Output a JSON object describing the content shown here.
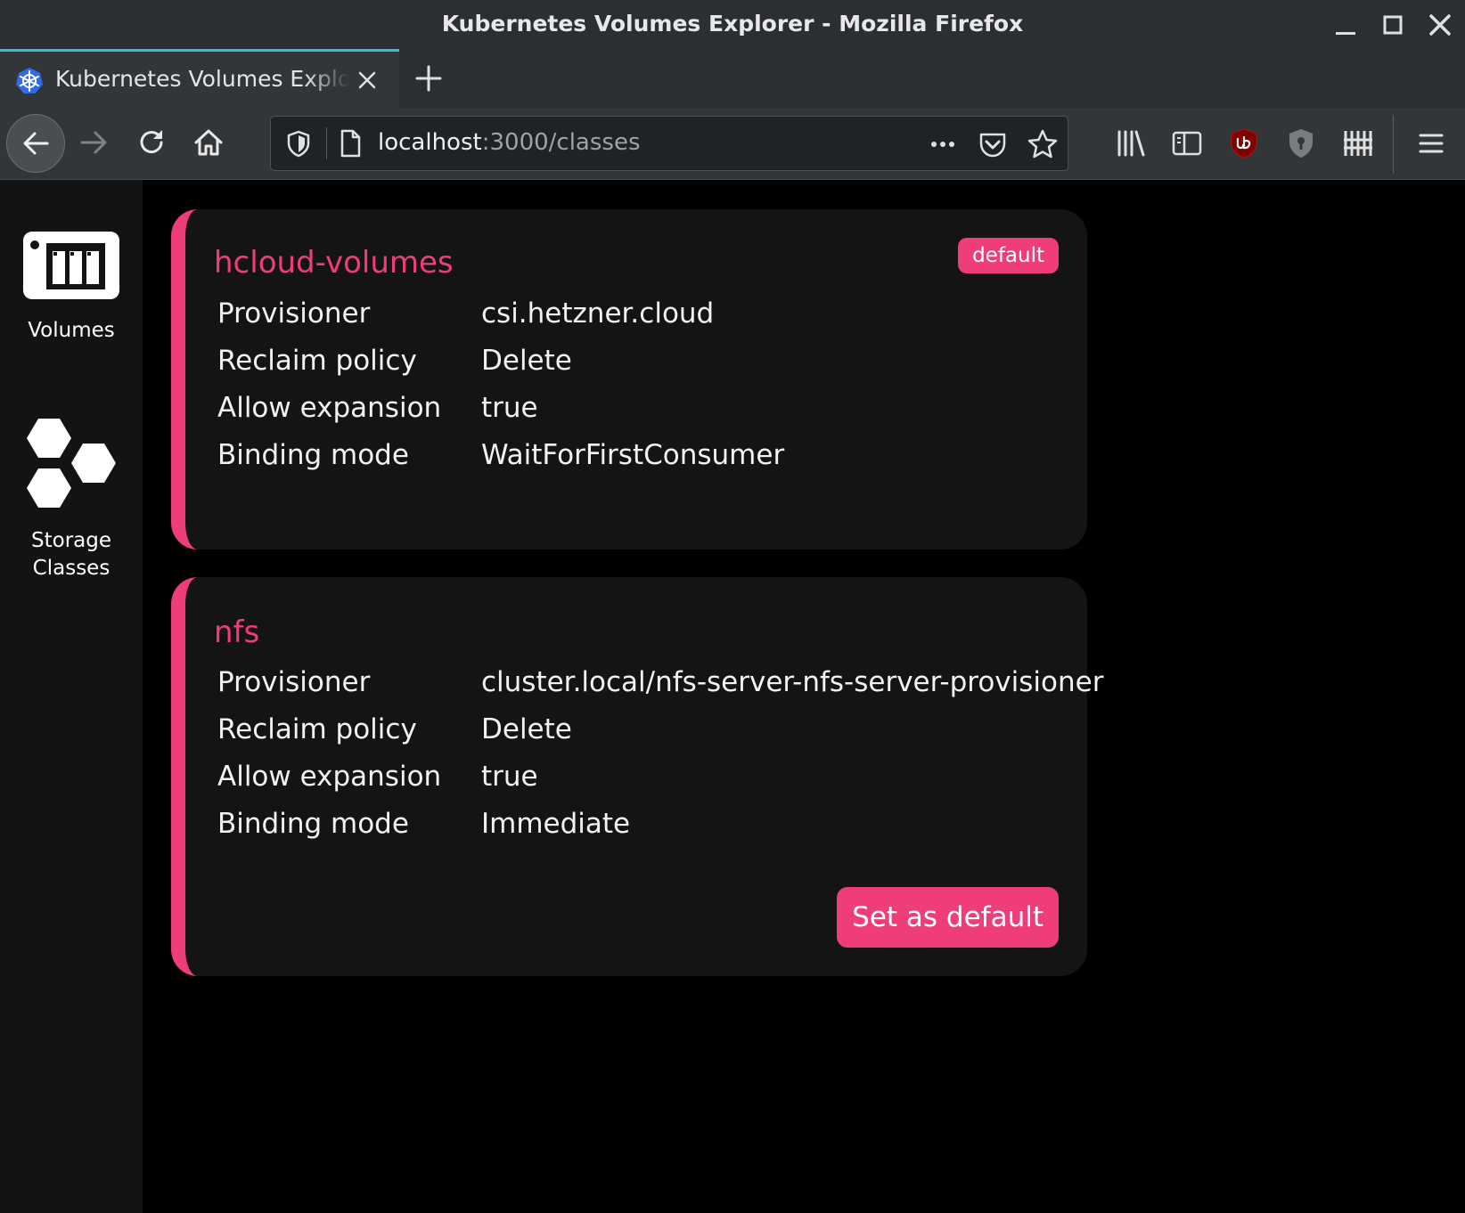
{
  "window": {
    "title": "Kubernetes Volumes Explorer - Mozilla Firefox"
  },
  "tabs": [
    {
      "title": "Kubernetes Volumes Explorer",
      "active": true,
      "favicon": "kubernetes-icon"
    }
  ],
  "toolbar": {
    "url_host": "localhost",
    "url_rest": ":3000/classes"
  },
  "colors": {
    "accent": "#ee3d78",
    "card_background": "#141414",
    "sidebar_background": "#131313",
    "tab_highlight": "#2ec4d0"
  },
  "sidebar": {
    "items": [
      {
        "label": "Volumes",
        "icon": "volumes-icon"
      },
      {
        "label_line1": "Storage",
        "label_line2": "Classes",
        "icon": "hexagons-icon"
      }
    ]
  },
  "storage_classes": [
    {
      "name": "hcloud-volumes",
      "badge": "default",
      "properties": [
        {
          "key": "Provisioner",
          "value": "csi.hetzner.cloud"
        },
        {
          "key": "Reclaim policy",
          "value": "Delete"
        },
        {
          "key": "Allow expansion",
          "value": "true"
        },
        {
          "key": "Binding mode",
          "value": "WaitForFirstConsumer"
        }
      ]
    },
    {
      "name": "nfs",
      "action_label": "Set as default",
      "properties": [
        {
          "key": "Provisioner",
          "value": "cluster.local/nfs-server-nfs-server-provisioner"
        },
        {
          "key": "Reclaim policy",
          "value": "Delete"
        },
        {
          "key": "Allow expansion",
          "value": "true"
        },
        {
          "key": "Binding mode",
          "value": "Immediate"
        }
      ]
    }
  ]
}
